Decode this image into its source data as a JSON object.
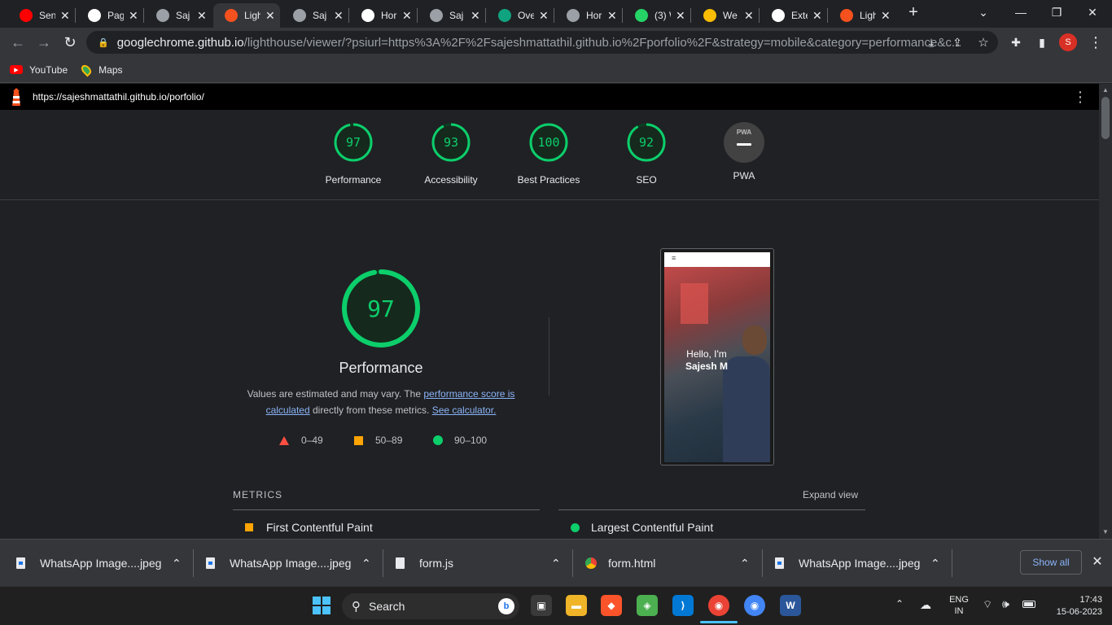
{
  "tabs": [
    {
      "label": "Sen",
      "icon": "youtube-icon",
      "color": "#ff0000"
    },
    {
      "label": "Pag",
      "icon": "github-icon",
      "color": "#ffffff"
    },
    {
      "label": "Saj",
      "icon": "globe-icon",
      "color": "#9aa0a6"
    },
    {
      "label": "Ligh",
      "icon": "lighthouse-icon",
      "color": "#f4511e"
    },
    {
      "label": "Saj",
      "icon": "globe-icon",
      "color": "#9aa0a6"
    },
    {
      "label": "Hor",
      "icon": "nike-icon",
      "color": "#ffffff"
    },
    {
      "label": "Saj",
      "icon": "globe-icon",
      "color": "#9aa0a6"
    },
    {
      "label": "Ove",
      "icon": "openai-icon",
      "color": "#10a37f"
    },
    {
      "label": "Hor",
      "icon": "globe-icon",
      "color": "#9aa0a6"
    },
    {
      "label": "(3) W",
      "icon": "whatsapp-icon",
      "color": "#25d366"
    },
    {
      "label": "We",
      "icon": "drive-icon",
      "color": "#fbbc04"
    },
    {
      "label": "Exte",
      "icon": "puzzle-icon",
      "color": "#ffffff"
    },
    {
      "label": "Ligh",
      "icon": "lighthouse-icon",
      "color": "#f4511e"
    }
  ],
  "active_tab_index": 3,
  "address": {
    "host": "googlechrome.github.io",
    "path": "/lighthouse/viewer/?psiurl=https%3A%2F%2Fsajeshmattathil.github.io%2Fporfolio%2F&strategy=mobile&category=performance&c..."
  },
  "profile_initial": "S",
  "bookmarks": [
    {
      "label": "YouTube",
      "icon": "youtube-icon"
    },
    {
      "label": "Maps",
      "icon": "maps-icon"
    }
  ],
  "lighthouse": {
    "url": "https://sajeshmattathil.github.io/porfolio/",
    "categories": [
      {
        "label": "Performance",
        "score": 97
      },
      {
        "label": "Accessibility",
        "score": 93
      },
      {
        "label": "Best Practices",
        "score": 100
      },
      {
        "label": "SEO",
        "score": 92
      }
    ],
    "pwa": {
      "label": "PWA",
      "badge": "PWA"
    },
    "main_score": 97,
    "main_title": "Performance",
    "desc_prefix": "Values are estimated and may vary. The ",
    "desc_link1": "performance score is calculated",
    "desc_middle": " directly from these metrics. ",
    "desc_link2": "See calculator.",
    "legend": [
      {
        "range": "0–49",
        "color": "#ff4e42"
      },
      {
        "range": "50–89",
        "color": "#ffa400"
      },
      {
        "range": "90–100",
        "color": "#0cce6b"
      }
    ],
    "metrics_label": "METRICS",
    "expand_label": "Expand view",
    "metrics": [
      {
        "name": "First Contentful Paint",
        "status": "average"
      },
      {
        "name": "Largest Contentful Paint",
        "status": "pass"
      }
    ],
    "screenshot": {
      "greeting": "Hello, I'm",
      "name": "Sajesh M"
    }
  },
  "downloads": [
    {
      "name": "WhatsApp Image....jpeg",
      "icon": "image-file-icon"
    },
    {
      "name": "WhatsApp Image....jpeg",
      "icon": "image-file-icon"
    },
    {
      "name": "form.js",
      "icon": "file-icon"
    },
    {
      "name": "form.html",
      "icon": "chrome-icon"
    },
    {
      "name": "WhatsApp Image....jpeg",
      "icon": "image-file-icon"
    }
  ],
  "show_all_label": "Show all",
  "taskbar": {
    "search_label": "Search",
    "lang_top": "ENG",
    "lang_bottom": "IN",
    "time": "17:43",
    "date": "15-06-2023"
  },
  "colors": {
    "pass": "#0cce6b",
    "average": "#ffa400",
    "fail": "#ff4e42"
  }
}
